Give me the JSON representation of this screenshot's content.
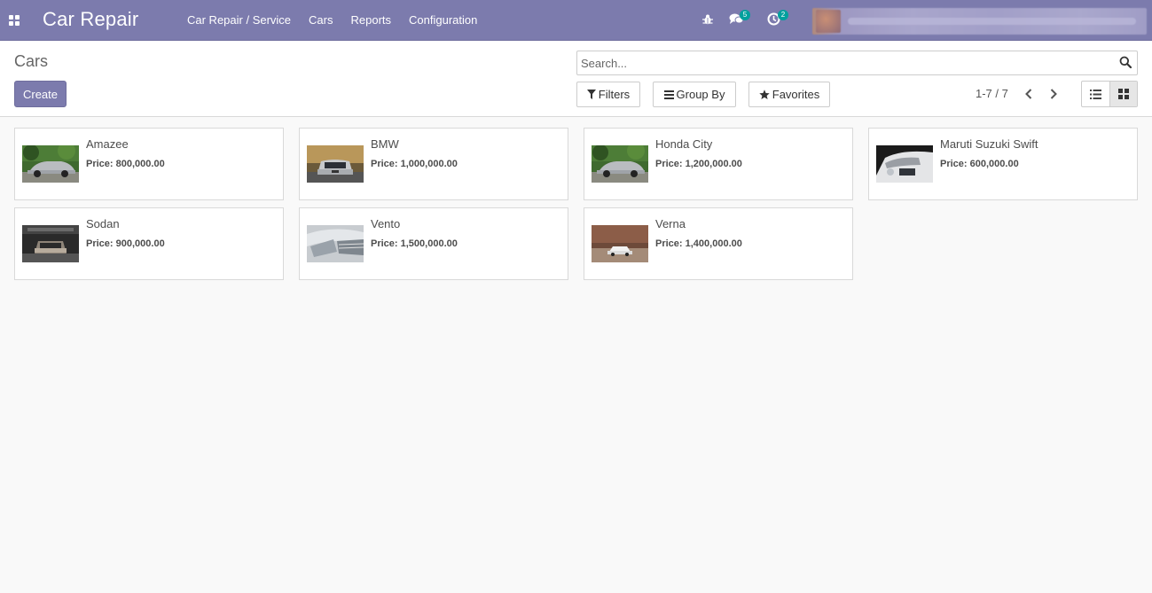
{
  "navbar": {
    "app_title": "Car Repair",
    "menu": [
      "Car Repair / Service",
      "Cars",
      "Reports",
      "Configuration"
    ],
    "messages_count": "5",
    "activities_count": "2",
    "color": "#7c7bad"
  },
  "control_panel": {
    "breadcrumb": "Cars",
    "create_label": "Create",
    "search_placeholder": "Search...",
    "filters_label": "Filters",
    "group_by_label": "Group By",
    "favorites_label": "Favorites",
    "pager": "1-7 / 7",
    "active_view": "kanban"
  },
  "cars": [
    {
      "name": "Amazee",
      "price": "Price: 800,000.00",
      "image": "silver-sports-car-trees"
    },
    {
      "name": "BMW",
      "price": "Price: 1,000,000.00",
      "image": "silver-bmw-front"
    },
    {
      "name": "Honda City",
      "price": "Price: 1,200,000.00",
      "image": "silver-sports-car-trees"
    },
    {
      "name": "Maruti Suzuki Swift",
      "price": "Price: 600,000.00",
      "image": "white-mercedes-front"
    },
    {
      "name": "Sodan",
      "price": "Price: 900,000.00",
      "image": "vintage-car-garage"
    },
    {
      "name": "Vento",
      "price": "Price: 1,500,000.00",
      "image": "silver-car-headlight"
    },
    {
      "name": "Verna",
      "price": "Price: 1,400,000.00",
      "image": "white-car-desert-road"
    }
  ]
}
